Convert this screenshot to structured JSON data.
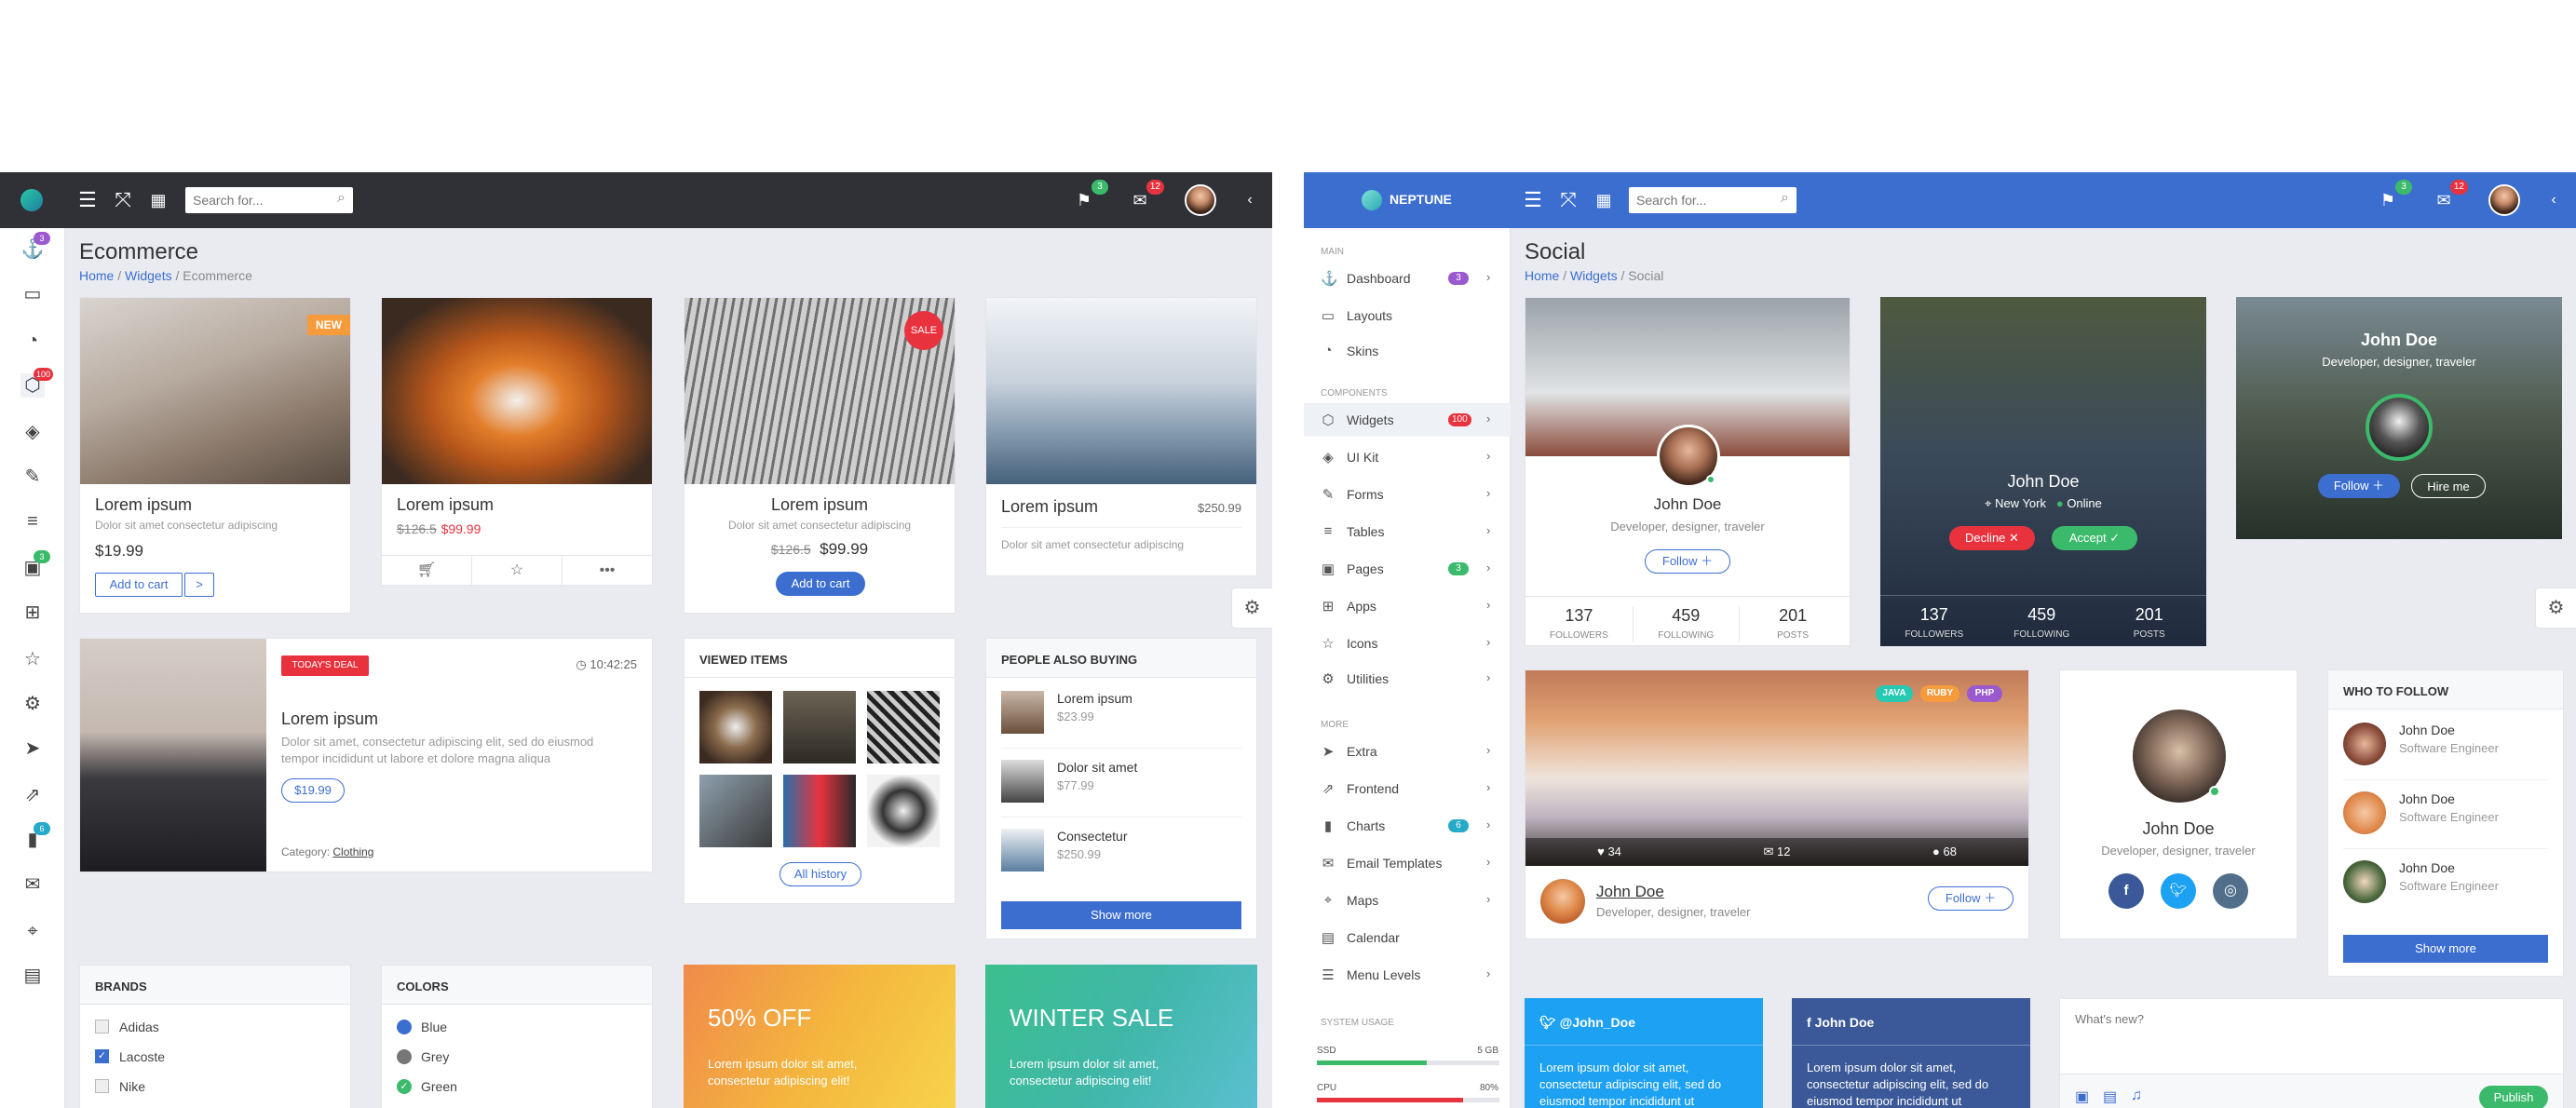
{
  "left": {
    "search_placeholder": "Search for...",
    "notif_count": "3",
    "mail_count": "12",
    "iconbar_badges": {
      "widgets": "3",
      "ecommerce": "100",
      "tables": "3",
      "charts": "6"
    },
    "page_title": "Ecommerce",
    "breadcrumb": {
      "home": "Home",
      "widgets": "Widgets",
      "current": "Ecommerce"
    },
    "products": [
      {
        "badge": "NEW",
        "name": "Lorem ipsum",
        "desc": "Dolor sit amet consectetur adipiscing",
        "price": "$19.99",
        "button": "Add to cart",
        "arrow": ">"
      },
      {
        "name": "Lorem ipsum",
        "old_price": "$126.5",
        "new_price": "$99.99"
      },
      {
        "badge": "SALE",
        "name": "Lorem ipsum",
        "desc": "Dolor sit amet consectetur adipiscing",
        "old_price": "$126.5",
        "new_price": "$99.99",
        "button": "Add to cart"
      },
      {
        "name": "Lorem ipsum",
        "price": "$250.99",
        "desc": "Dolor sit amet consectetur adipiscing"
      }
    ],
    "deal": {
      "badge": "TODAY'S DEAL",
      "time": "10:42:25",
      "name": "Lorem ipsum",
      "desc": "Dolor sit amet, consectetur adipiscing elit, sed do eiusmod tempor incididunt ut labore et dolore magna aliqua",
      "price": "$19.99",
      "category_label": "Category:",
      "category": "Clothing"
    },
    "viewed": {
      "title": "VIEWED ITEMS",
      "button": "All history"
    },
    "also": {
      "title": "PEOPLE ALSO BUYING",
      "items": [
        {
          "name": "Lorem ipsum",
          "price": "$23.99"
        },
        {
          "name": "Dolor sit amet",
          "price": "$77.99"
        },
        {
          "name": "Consectetur",
          "price": "$250.99"
        }
      ],
      "button": "Show more"
    },
    "brands": {
      "title": "BRANDS",
      "items": [
        "Adidas",
        "Lacoste",
        "Nike"
      ]
    },
    "colors": {
      "title": "COLORS",
      "items": [
        "Blue",
        "Grey",
        "Green"
      ]
    },
    "promo1": {
      "title": "50% OFF",
      "text": "Lorem ipsum dolor sit amet, consectetur adipiscing elit!"
    },
    "promo2": {
      "title": "WINTER SALE",
      "text": "Lorem ipsum dolor sit amet, consectetur adipiscing elit!"
    }
  },
  "right": {
    "brand": "NEPTUNE",
    "search_placeholder": "Search for...",
    "notif_count": "3",
    "mail_count": "12",
    "sections": {
      "main": "MAIN",
      "components": "COMPONENTS",
      "more": "MORE",
      "system": "SYSTEM USAGE"
    },
    "menu_main": [
      {
        "label": "Dashboard",
        "badge": "3"
      },
      {
        "label": "Layouts"
      },
      {
        "label": "Skins"
      }
    ],
    "menu_components": [
      {
        "label": "Widgets",
        "badge": "100"
      },
      {
        "label": "UI Kit"
      },
      {
        "label": "Forms"
      },
      {
        "label": "Tables"
      },
      {
        "label": "Pages",
        "badge": "3"
      },
      {
        "label": "Apps"
      },
      {
        "label": "Icons"
      },
      {
        "label": "Utilities"
      }
    ],
    "menu_more": [
      {
        "label": "Extra"
      },
      {
        "label": "Frontend"
      },
      {
        "label": "Charts",
        "badge": "6"
      },
      {
        "label": "Email Templates"
      },
      {
        "label": "Maps"
      },
      {
        "label": "Calendar"
      },
      {
        "label": "Menu Levels"
      }
    ],
    "usage": {
      "ssd_label": "SSD",
      "ssd_value": "5 GB",
      "ssd_pct": 0.6,
      "cpu_label": "CPU",
      "cpu_value": "80%",
      "cpu_pct": 0.8
    },
    "page_title": "Social",
    "breadcrumb": {
      "home": "Home",
      "widgets": "Widgets",
      "current": "Social"
    },
    "profile1": {
      "name": "John Doe",
      "role": "Developer, designer, traveler",
      "button": "Follow",
      "stats": [
        {
          "v": "137",
          "l": "FOLLOWERS"
        },
        {
          "v": "459",
          "l": "FOLLOWING"
        },
        {
          "v": "201",
          "l": "POSTS"
        }
      ]
    },
    "profile2": {
      "name": "John Doe",
      "location": "New York",
      "status": "Online",
      "decline": "Decline",
      "accept": "Accept",
      "stats": [
        {
          "v": "137",
          "l": "FOLLOWERS"
        },
        {
          "v": "459",
          "l": "FOLLOWING"
        },
        {
          "v": "201",
          "l": "POSTS"
        }
      ]
    },
    "profile3": {
      "name": "John Doe",
      "role": "Developer, designer, traveler",
      "follow": "Follow",
      "hire": "Hire me"
    },
    "post": {
      "tags": [
        "JAVA",
        "RUBY",
        "PHP"
      ],
      "likes": "34",
      "comments": "12",
      "users": "68",
      "name": "John Doe",
      "role": "Developer, designer, traveler",
      "button": "Follow"
    },
    "profile4": {
      "name": "John Doe",
      "role": "Developer, designer, traveler"
    },
    "who": {
      "title": "WHO TO FOLLOW",
      "items": [
        {
          "name": "John Doe",
          "role": "Software Engineer"
        },
        {
          "name": "John Doe",
          "role": "Software Engineer"
        },
        {
          "name": "John Doe",
          "role": "Software Engineer"
        }
      ],
      "button": "Show more"
    },
    "twitter": {
      "handle": "@John_Doe",
      "text": "Lorem ipsum dolor sit amet, consectetur adipiscing elit, sed do eiusmod tempor incididunt ut"
    },
    "facebook": {
      "handle": "John Doe",
      "text": "Lorem ipsum dolor sit amet, consectetur adipiscing elit, sed do eiusmod tempor incididunt ut"
    },
    "composer": {
      "placeholder": "What's new?",
      "button": "Publish"
    }
  }
}
